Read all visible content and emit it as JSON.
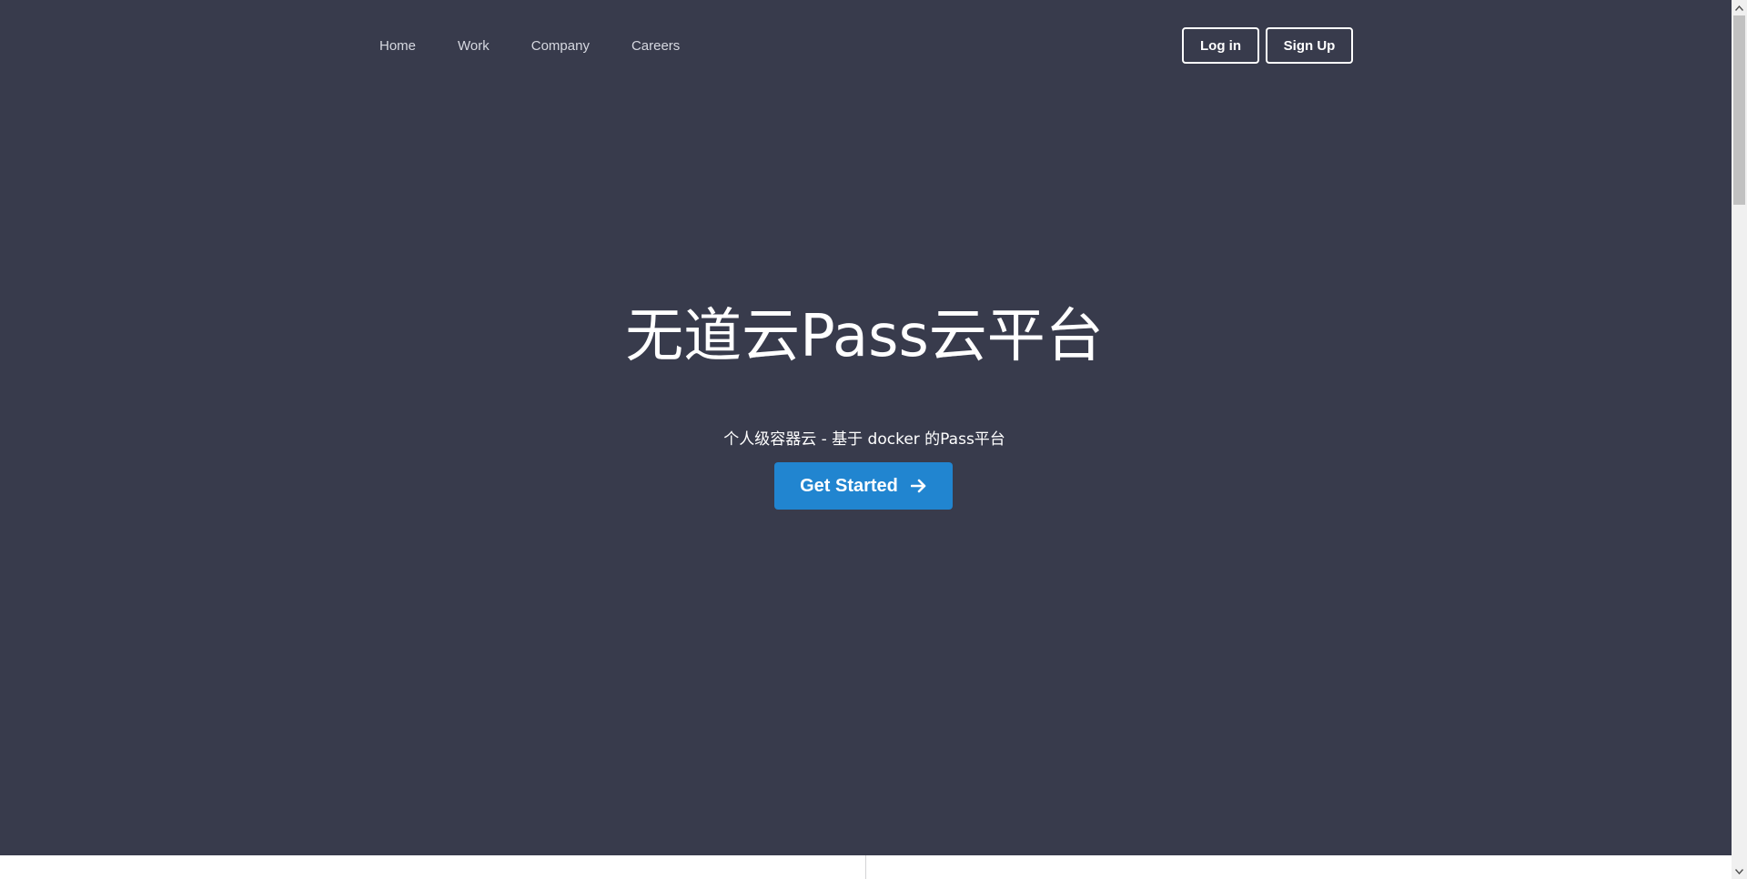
{
  "nav": {
    "items": [
      {
        "label": "Home"
      },
      {
        "label": "Work"
      },
      {
        "label": "Company"
      },
      {
        "label": "Careers"
      }
    ],
    "login_label": "Log in",
    "signup_label": "Sign Up"
  },
  "hero": {
    "title": "无道云Pass云平台",
    "subtitle": "个人级容器云 - 基于 docker 的Pass平台",
    "cta_label": "Get Started",
    "cta_icon": "arrow-right-icon"
  },
  "colors": {
    "background": "#383b4c",
    "primary": "#2185d0",
    "text": "#ffffff"
  }
}
